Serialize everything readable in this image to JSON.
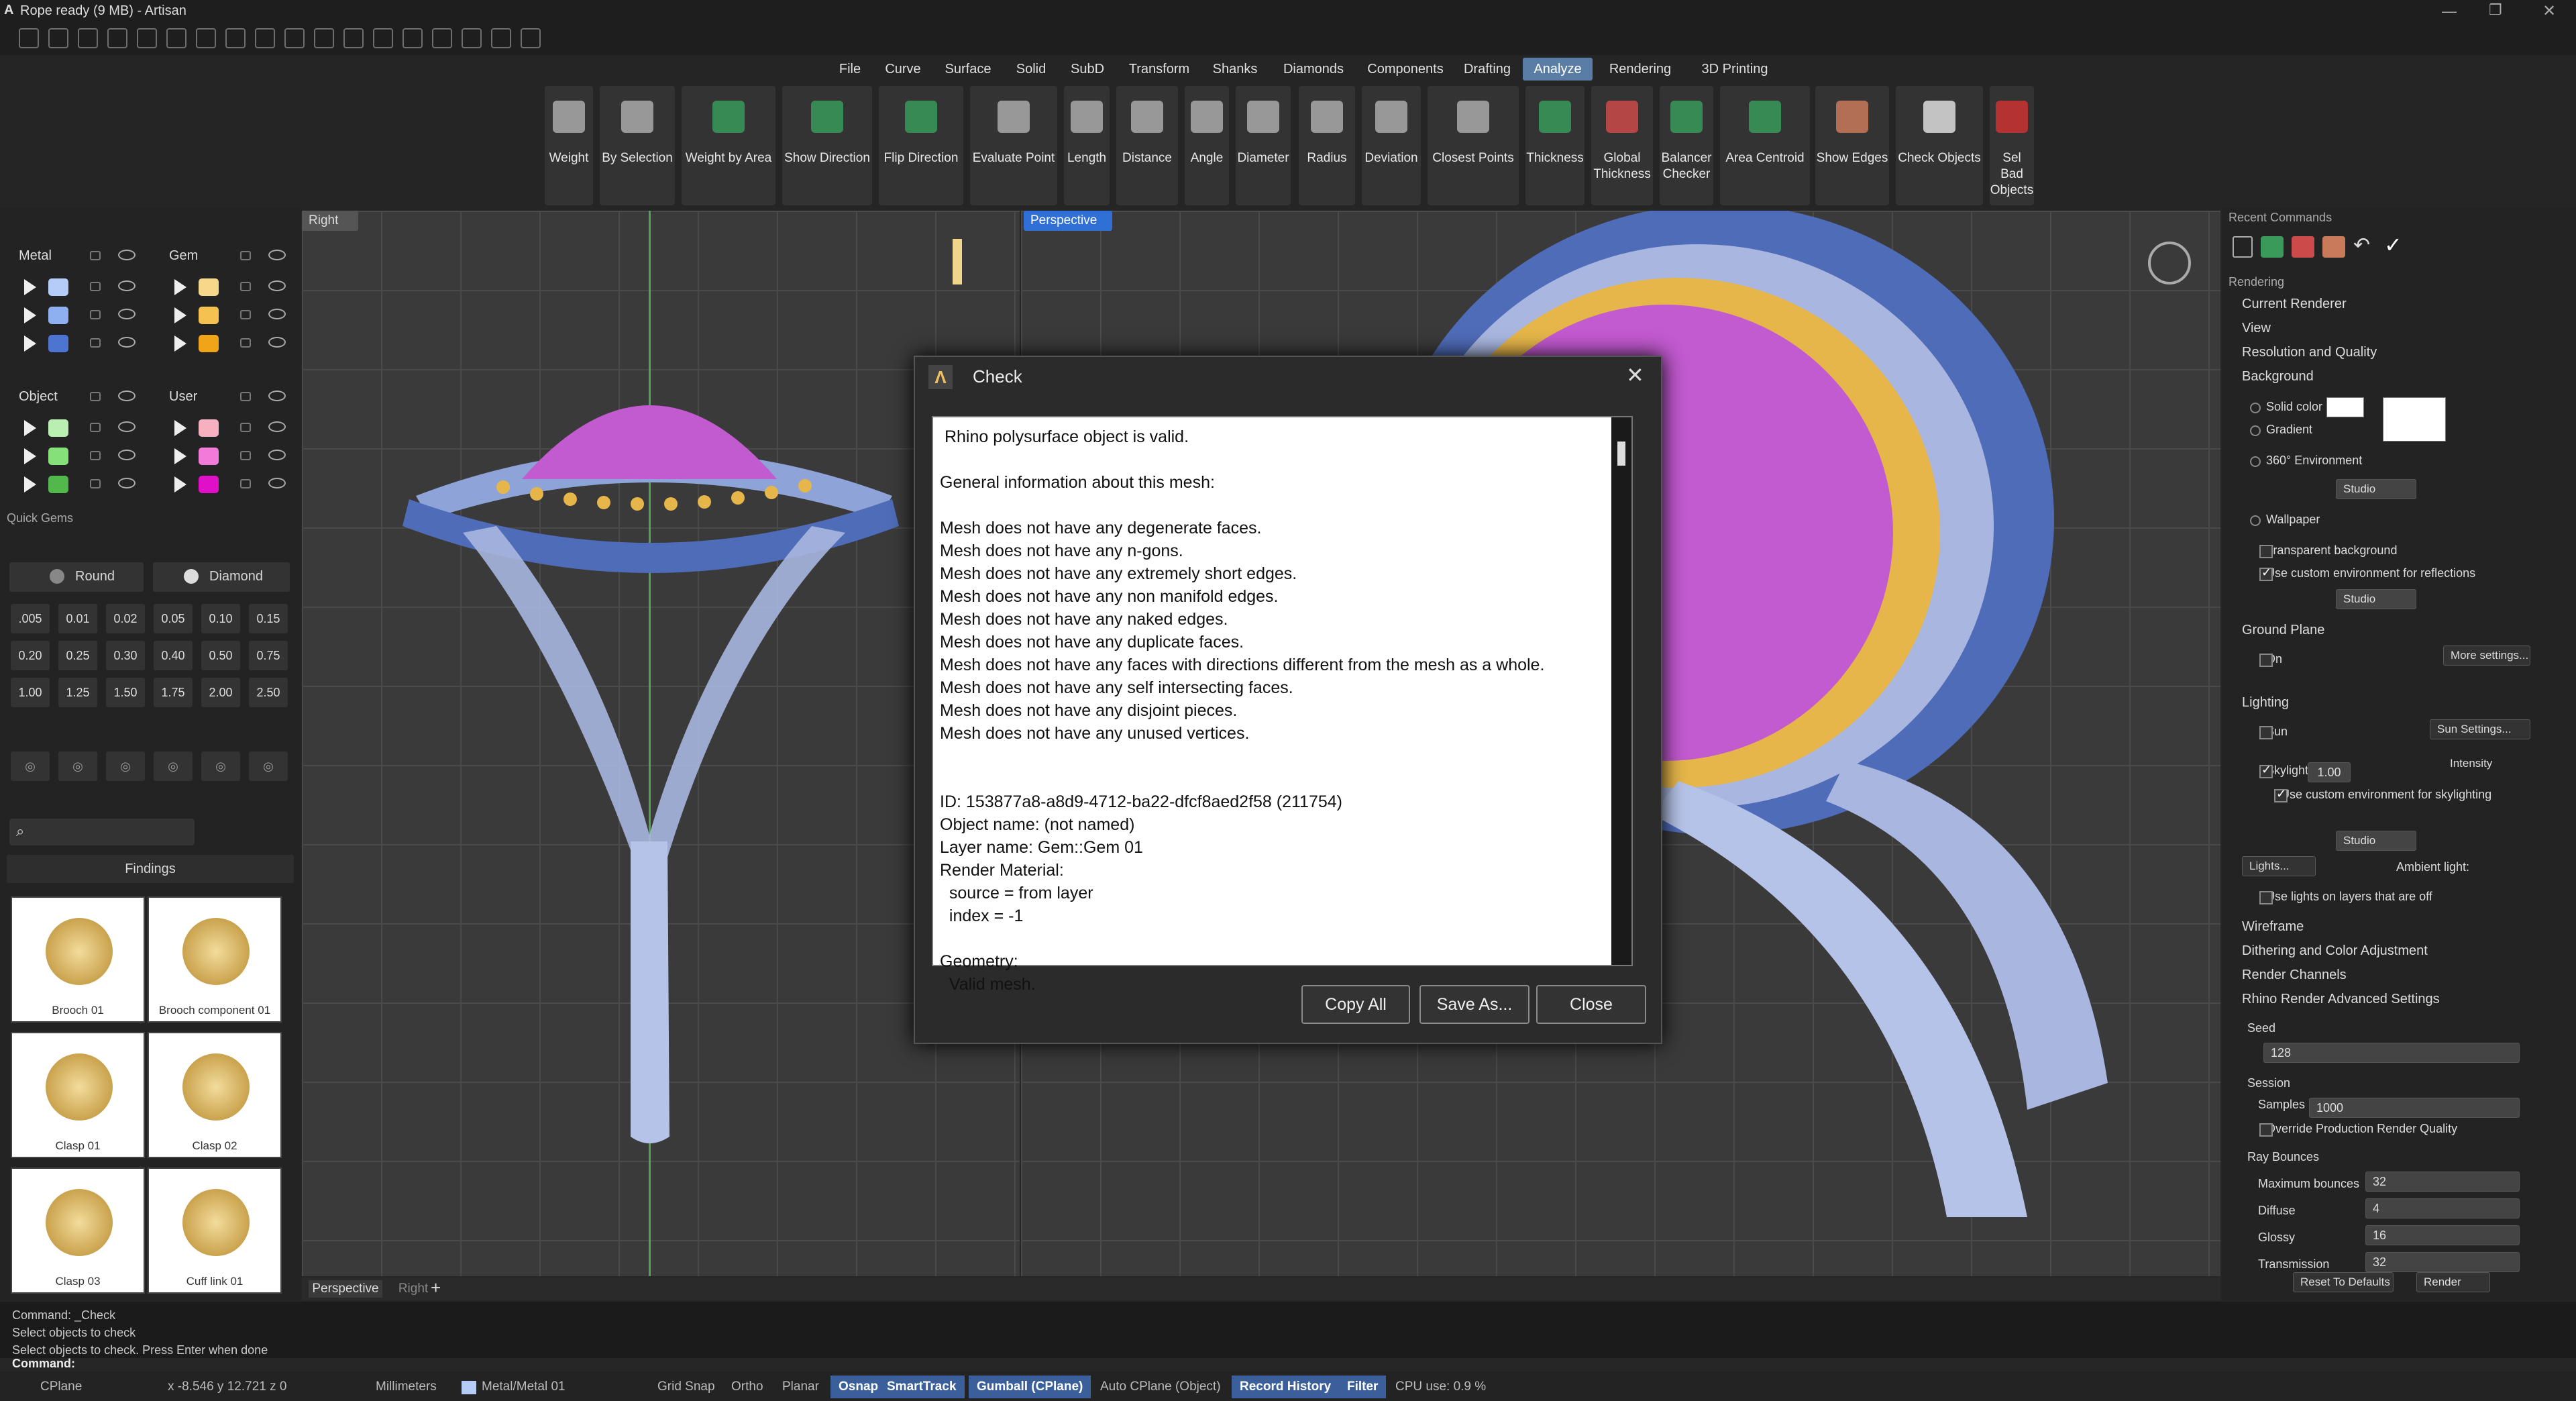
{
  "window": {
    "title": "Rope ready (9 MB) - Artisan"
  },
  "menus": [
    "File",
    "Curve",
    "Surface",
    "Solid",
    "SubD",
    "Transform",
    "Shanks",
    "Diamonds",
    "Components",
    "Drafting",
    "Analyze",
    "Rendering",
    "3D Printing"
  ],
  "ribbon": [
    "Weight",
    "By Selection",
    "Weight by Area",
    "Show Direction",
    "Flip Direction",
    "Evaluate Point",
    "Length",
    "Distance",
    "Angle",
    "Diameter",
    "Radius",
    "Deviation",
    "Closest Points",
    "Thickness",
    "Global Thickness",
    "Balancer Checker",
    "Area Centroid",
    "Show Edges",
    "Check Objects",
    "Sel Bad Objects"
  ],
  "layers": {
    "groups": [
      {
        "name": "Metal",
        "colors": [
          "#b6ccf8",
          "#8fb0f0",
          "#4d74d0"
        ]
      },
      {
        "name": "Gem",
        "colors": [
          "#f7d78a",
          "#f5c251",
          "#f0a418"
        ]
      },
      {
        "name": "Object",
        "colors": [
          "#b9efb0",
          "#86e07a",
          "#52b84c"
        ]
      },
      {
        "name": "User",
        "colors": [
          "#f7b0c0",
          "#f27ad8",
          "#e010c8"
        ]
      }
    ]
  },
  "quick_gems": {
    "title": "Quick Gems",
    "shape": "Round",
    "material": "Diamond",
    "sizes": [
      "0.05",
      "0.10",
      "0.15",
      "0.20",
      "0.25",
      "0.30",
      "0.40",
      "0.50",
      "0.75",
      "1.00",
      "1.25",
      "1.50",
      "1.75",
      "2.00",
      "2.50"
    ],
    "sizes_row0": [
      ".005",
      "0.01",
      "0.02"
    ]
  },
  "library": {
    "category": "Findings",
    "items": [
      "Brooch 01",
      "Brooch component 01",
      "Clasp 01",
      "Clasp 02",
      "Clasp 03",
      "Cuff link 01"
    ]
  },
  "viewports": {
    "left_label": "Right",
    "right_label": "Perspective",
    "tabs": [
      "Perspective",
      "Right"
    ]
  },
  "dialog": {
    "title": "Check",
    "text": " Rhino polysurface object is valid.\n\nGeneral information about this mesh:\n\nMesh does not have any degenerate faces.\nMesh does not have any n-gons.\nMesh does not have any extremely short edges.\nMesh does not have any non manifold edges.\nMesh does not have any naked edges.\nMesh does not have any duplicate faces.\nMesh does not have any faces with directions different from the mesh as a whole.\nMesh does not have any self intersecting faces.\nMesh does not have any disjoint pieces.\nMesh does not have any unused vertices.\n\n\nID: 153877a8-a8d9-4712-ba22-dfcf8aed2f58 (211754)\nObject name: (not named)\nLayer name: Gem::Gem 01\nRender Material:\n  source = from layer\n  index = -1\n\nGeometry:\n  Valid mesh.",
    "buttons": [
      "Copy All",
      "Save As...",
      "Close"
    ]
  },
  "right_panel": {
    "recent": "Recent Commands",
    "rendering": "Rendering",
    "sections": [
      "Current Renderer",
      "View",
      "Resolution and Quality",
      "Background"
    ],
    "bg": {
      "solid": "Solid color",
      "gradient": "Gradient",
      "env": "360° Environment",
      "studio": "Studio",
      "wallpaper": "Wallpaper",
      "transparent": "Transparent background",
      "custom_env": "Use custom environment for reflections"
    },
    "ground": {
      "title": "Ground Plane",
      "on": "On",
      "more": "More settings..."
    },
    "lighting": {
      "title": "Lighting",
      "sun": "Sun",
      "sun_settings": "Sun Settings...",
      "intensity": "Intensity",
      "skylight": "Skylight",
      "skylight_value": "1.00",
      "custom_sky": "Use custom environment for skylighting",
      "lights": "Lights...",
      "ambient": "Ambient light:",
      "layers_off": "Use lights on layers that are off"
    },
    "more_sections": [
      "Wireframe",
      "Dithering and Color Adjustment",
      "Render Channels",
      "Rhino Render Advanced Settings"
    ],
    "seed_label": "Seed",
    "seed": "128",
    "session": "Session",
    "samples_label": "Samples",
    "samples": "1000",
    "override": "Override Production Render Quality",
    "bounces_title": "Ray Bounces",
    "bounces": [
      {
        "label": "Maximum bounces",
        "value": "32"
      },
      {
        "label": "Diffuse",
        "value": "4"
      },
      {
        "label": "Glossy",
        "value": "16"
      },
      {
        "label": "Transmission",
        "value": "32"
      }
    ],
    "reset": "Reset To Defaults",
    "render": "Render"
  },
  "command": {
    "history": [
      "Command: _Check",
      "Select objects to check",
      "Select objects to check. Press Enter when done"
    ],
    "prompt": "Command:"
  },
  "status": {
    "cplane": "CPlane",
    "coords": "x -8.546   y 12.721   z 0",
    "units": "Millimeters",
    "layer": "Metal/Metal 01",
    "toggles": [
      "Grid Snap",
      "Ortho",
      "Planar",
      "Osnap",
      "SmartTrack",
      "Gumball (CPlane)",
      "Auto CPlane (Object)",
      "Record History",
      "Filter"
    ],
    "cpu": "CPU use: 0.9 %"
  }
}
